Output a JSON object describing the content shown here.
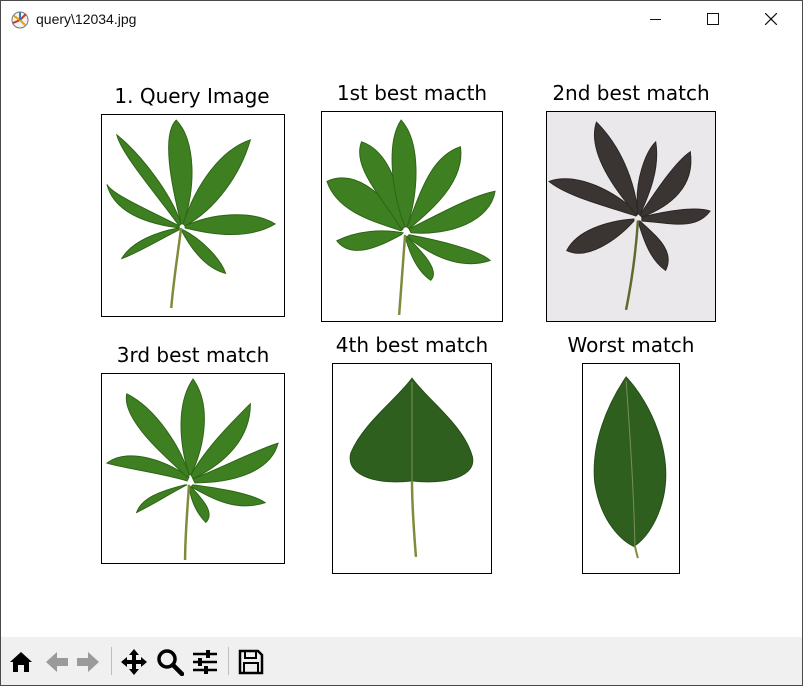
{
  "window": {
    "title": "query\\12034.jpg"
  },
  "figure": {
    "panels": [
      {
        "title": "1. Query Image"
      },
      {
        "title": "1st best macth"
      },
      {
        "title": "2nd best match"
      },
      {
        "title": "3rd best match"
      },
      {
        "title": "4th best match"
      },
      {
        "title": "Worst match"
      }
    ]
  },
  "toolbar": {
    "buttons": [
      "home-icon",
      "back-icon",
      "forward-icon",
      "pan-icon",
      "zoom-icon",
      "configure-subplots-icon",
      "save-icon"
    ]
  },
  "colors": {
    "leaf_green": "#3e7f22",
    "leaf_dark": "#3a3532",
    "toolbar_bg": "#f0f0f0"
  }
}
